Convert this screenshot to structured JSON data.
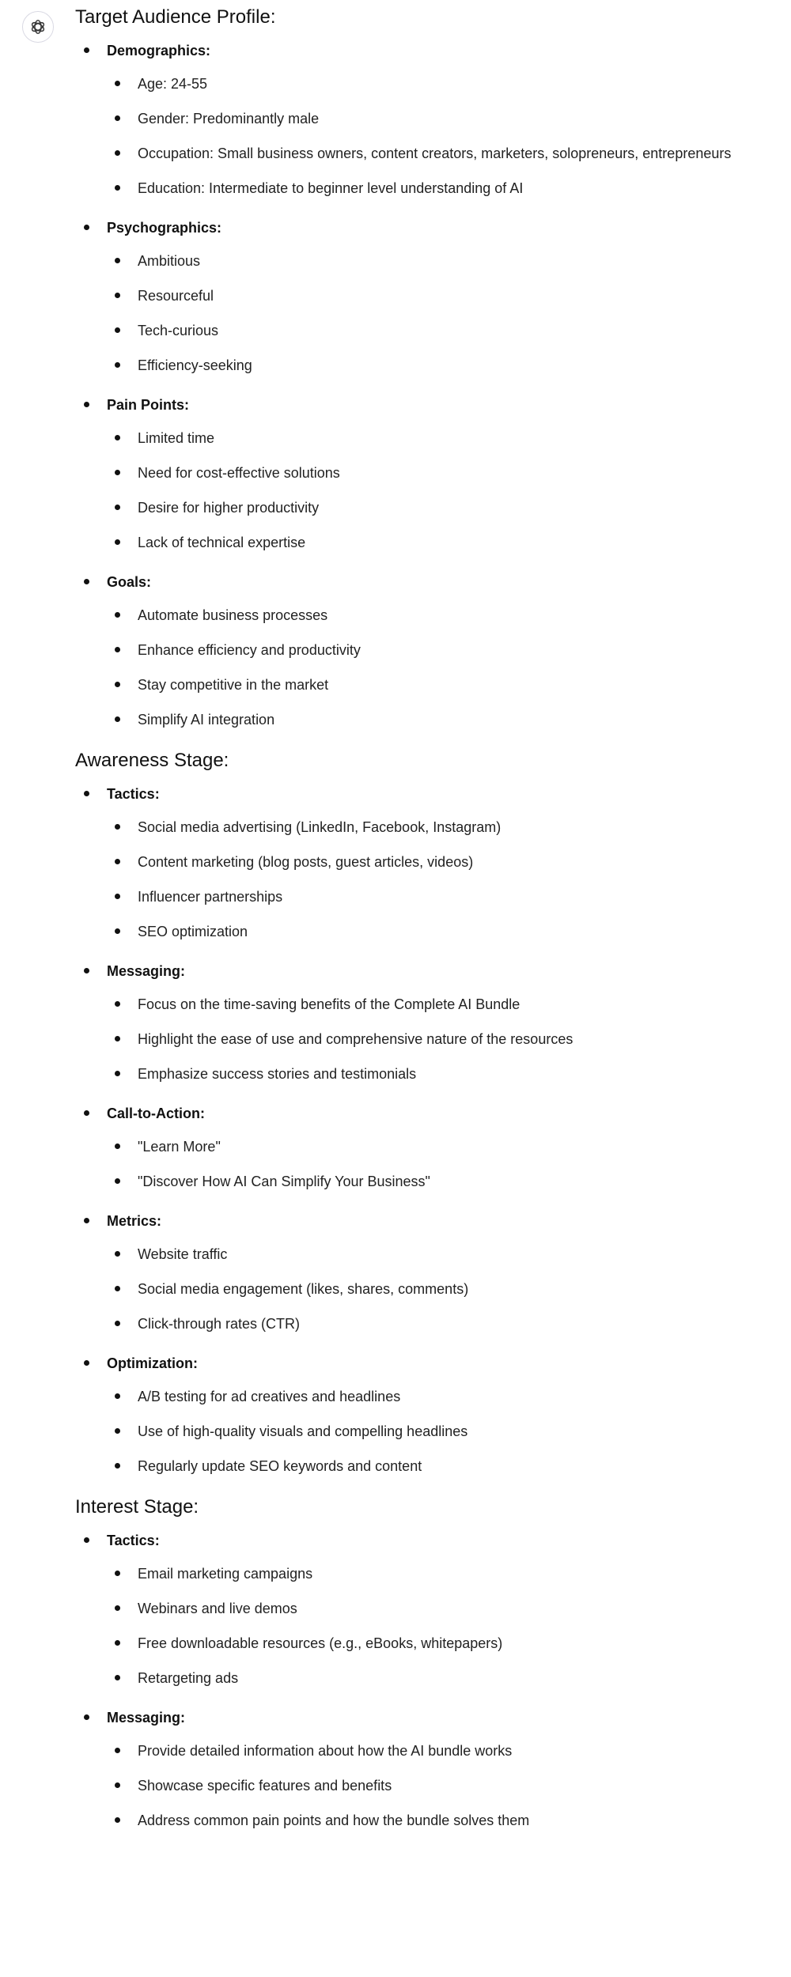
{
  "sections": [
    {
      "title": "Target Audience Profile:",
      "groups": [
        {
          "label": "Demographics:",
          "items": [
            "Age: 24-55",
            "Gender: Predominantly male",
            "Occupation: Small business owners, content creators, marketers, solopreneurs, entrepreneurs",
            "Education: Intermediate to beginner level understanding of AI"
          ]
        },
        {
          "label": "Psychographics:",
          "items": [
            "Ambitious",
            "Resourceful",
            "Tech-curious",
            "Efficiency-seeking"
          ]
        },
        {
          "label": "Pain Points:",
          "items": [
            "Limited time",
            "Need for cost-effective solutions",
            "Desire for higher productivity",
            "Lack of technical expertise"
          ]
        },
        {
          "label": "Goals:",
          "items": [
            "Automate business processes",
            "Enhance efficiency and productivity",
            "Stay competitive in the market",
            "Simplify AI integration"
          ]
        }
      ]
    },
    {
      "title": "Awareness Stage:",
      "groups": [
        {
          "label": "Tactics:",
          "items": [
            "Social media advertising (LinkedIn, Facebook, Instagram)",
            "Content marketing (blog posts, guest articles, videos)",
            "Influencer partnerships",
            "SEO optimization"
          ]
        },
        {
          "label": "Messaging:",
          "items": [
            "Focus on the time-saving benefits of the Complete AI Bundle",
            "Highlight the ease of use and comprehensive nature of the resources",
            "Emphasize success stories and testimonials"
          ]
        },
        {
          "label": "Call-to-Action:",
          "items": [
            "\"Learn More\"",
            "\"Discover How AI Can Simplify Your Business\""
          ]
        },
        {
          "label": "Metrics:",
          "items": [
            "Website traffic",
            "Social media engagement (likes, shares, comments)",
            "Click-through rates (CTR)"
          ]
        },
        {
          "label": "Optimization:",
          "items": [
            "A/B testing for ad creatives and headlines",
            "Use of high-quality visuals and compelling headlines",
            "Regularly update SEO keywords and content"
          ]
        }
      ]
    },
    {
      "title": "Interest Stage:",
      "groups": [
        {
          "label": "Tactics:",
          "items": [
            "Email marketing campaigns",
            "Webinars and live demos",
            "Free downloadable resources (e.g., eBooks, whitepapers)",
            "Retargeting ads"
          ]
        },
        {
          "label": "Messaging:",
          "items": [
            "Provide detailed information about how the AI bundle works",
            "Showcase specific features and benefits",
            "Address common pain points and how the bundle solves them"
          ]
        }
      ]
    }
  ]
}
